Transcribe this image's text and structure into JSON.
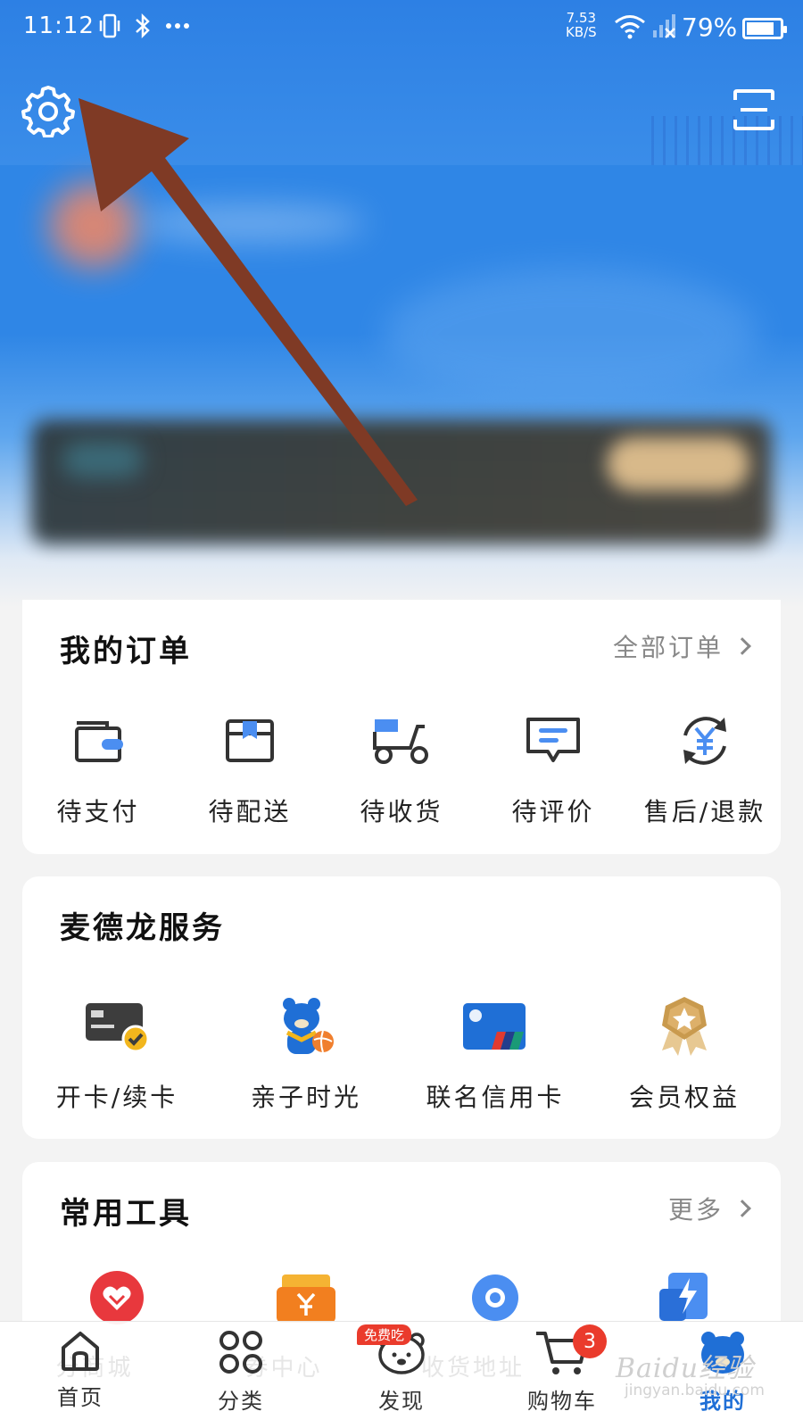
{
  "status_bar": {
    "time": "11:12",
    "left_icons": [
      "vibrate-icon",
      "bluetooth-icon",
      "more-dots-icon"
    ],
    "speed_value": "7.53",
    "speed_unit": "KB/S",
    "battery": "79%"
  },
  "header": {
    "settings_icon": "gear-icon",
    "scan_icon": "scan-icon"
  },
  "orders": {
    "title": "我的订单",
    "more_label": "全部订单",
    "items": [
      {
        "label": "待支付",
        "icon": "wallet-icon"
      },
      {
        "label": "待配送",
        "icon": "package-box-icon"
      },
      {
        "label": "待收货",
        "icon": "delivery-scooter-icon"
      },
      {
        "label": "待评价",
        "icon": "comment-icon"
      },
      {
        "label": "售后/退款",
        "icon": "refund-yuan-icon"
      }
    ]
  },
  "services": {
    "title": "麦德龙服务",
    "items": [
      {
        "label": "开卡/续卡",
        "icon": "member-card-icon"
      },
      {
        "label": "亲子时光",
        "icon": "bear-mascot-icon"
      },
      {
        "label": "联名信用卡",
        "icon": "credit-card-icon"
      },
      {
        "label": "会员权益",
        "icon": "medal-icon"
      }
    ]
  },
  "tools": {
    "title": "常用工具",
    "more_label": "更多",
    "items": [
      {
        "label": "分商城",
        "icon": "heart-icon"
      },
      {
        "label": "券中心",
        "icon": "coupon-icon"
      },
      {
        "label": "收货地址",
        "icon": "location-icon"
      },
      {
        "label": "",
        "icon": "lightning-icon"
      }
    ]
  },
  "bottom_nav": {
    "items": [
      {
        "label": "首页",
        "icon": "home-icon"
      },
      {
        "label": "分类",
        "icon": "category-grid-icon"
      },
      {
        "label": "发现",
        "icon": "discover-bear-icon",
        "tag": "免费吃"
      },
      {
        "label": "购物车",
        "icon": "cart-icon",
        "badge": "3"
      },
      {
        "label": "我的",
        "icon": "profile-bear-icon"
      }
    ]
  },
  "watermark": {
    "text": "Baidu经验",
    "url": "jingyan.baidu.com"
  },
  "colors": {
    "header_blue": "#2f86e6",
    "active_nav": "#1f6fd6",
    "badge_red": "#ea3b2c",
    "arrow_brown": "#7f3a25"
  }
}
